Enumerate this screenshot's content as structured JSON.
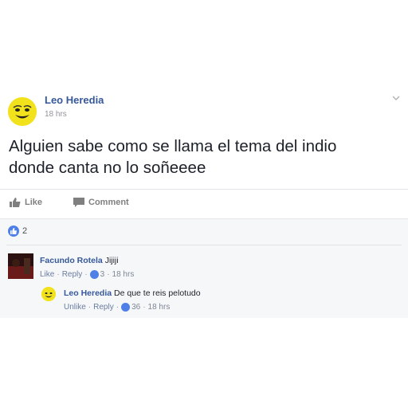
{
  "post": {
    "author": "Leo Heredia",
    "time": "18 hrs",
    "text": "Alguien sabe como se llama el tema del indio donde canta no lo soñeeee"
  },
  "actions": {
    "like": "Like",
    "comment": "Comment"
  },
  "reactions": {
    "count": "2"
  },
  "comments": [
    {
      "author": "Facundo Rotela",
      "text": "Jijiji",
      "like": "Like",
      "reply": "Reply",
      "likes": "3",
      "time": "18 hrs"
    },
    {
      "author": "Leo Heredia",
      "text": "De que te reis pelotudo",
      "like": "Unlike",
      "reply": "Reply",
      "likes": "36",
      "time": "18 hrs"
    }
  ],
  "colors": {
    "name_blue": "#365899",
    "like_blue": "#4f80e8",
    "avatar_yellow": "#f2e21c"
  }
}
